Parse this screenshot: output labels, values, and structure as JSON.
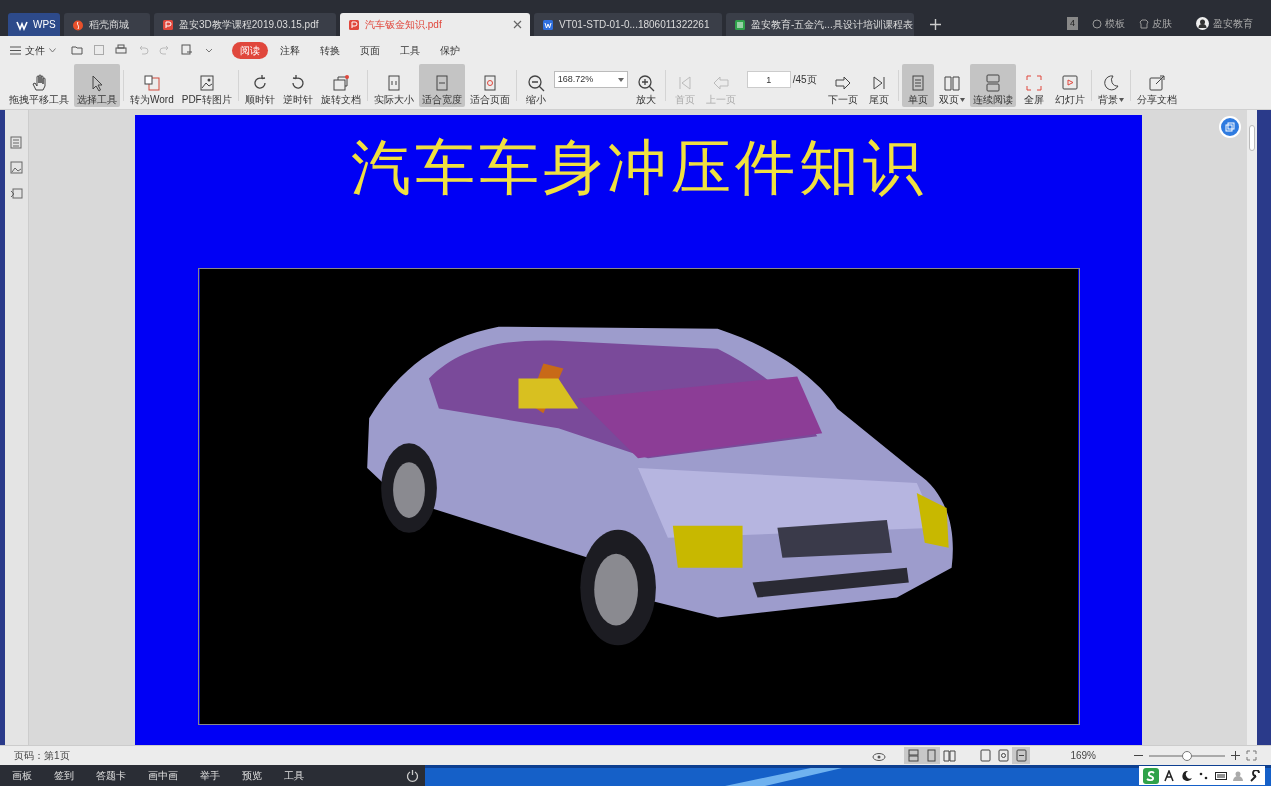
{
  "tabs": [
    {
      "label": "WPS",
      "kind": "home",
      "selected": false
    },
    {
      "label": "稻壳商城",
      "kind": "store",
      "selected": false
    },
    {
      "label": "盈安3D教学课程2019.03.15.pdf",
      "kind": "pdf",
      "selected": false
    },
    {
      "label": "汽车钣金知识.pdf",
      "kind": "pdf",
      "selected": true
    },
    {
      "label": "VT01-STD-01-0...1806011322261",
      "kind": "doc",
      "selected": false
    },
    {
      "label": "盈安教育-五金汽...具设计培训课程表",
      "kind": "sheet",
      "selected": false
    }
  ],
  "title_right": {
    "badge": "4",
    "template": "模板",
    "skin": "皮肤",
    "user": "盈安教育"
  },
  "menu": {
    "file": "文件",
    "items": [
      {
        "label": "阅读",
        "selected": true
      },
      {
        "label": "注释",
        "selected": false
      },
      {
        "label": "转换",
        "selected": false
      },
      {
        "label": "页面",
        "selected": false
      },
      {
        "label": "工具",
        "selected": false
      },
      {
        "label": "保护",
        "selected": false
      }
    ]
  },
  "toolbar": [
    [
      {
        "kind": "button",
        "label": "拖拽平移工具",
        "selected": false,
        "disabled": false
      },
      {
        "kind": "button",
        "label": "选择工具",
        "selected": true,
        "disabled": false
      }
    ],
    [
      {
        "kind": "button",
        "label": "转为Word",
        "selected": false,
        "disabled": false
      },
      {
        "kind": "button",
        "label": "PDF转图片",
        "selected": false,
        "disabled": false
      }
    ],
    [
      {
        "kind": "button",
        "label": "顺时针",
        "selected": false,
        "disabled": false
      },
      {
        "kind": "button",
        "label": "逆时针",
        "selected": false,
        "disabled": false
      },
      {
        "kind": "button",
        "label": "旋转文档",
        "selected": false,
        "disabled": false
      }
    ],
    [
      {
        "kind": "button",
        "label": "实际大小",
        "selected": false,
        "disabled": false
      },
      {
        "kind": "button",
        "label": "适合宽度",
        "selected": true,
        "disabled": false
      },
      {
        "kind": "button",
        "label": "适合页面",
        "selected": false,
        "disabled": false
      }
    ],
    [
      {
        "kind": "button",
        "label": "缩小",
        "selected": false,
        "disabled": false
      },
      {
        "kind": "zoom",
        "value": "168.72%"
      },
      {
        "kind": "button",
        "label": "放大",
        "selected": false,
        "disabled": false
      }
    ],
    [
      {
        "kind": "button",
        "label": "首页",
        "selected": false,
        "disabled": true
      },
      {
        "kind": "button",
        "label": "上一页",
        "selected": false,
        "disabled": true
      },
      {
        "kind": "page",
        "value": "1",
        "total": "/45页"
      },
      {
        "kind": "button",
        "label": "下一页",
        "selected": false,
        "disabled": false
      },
      {
        "kind": "button",
        "label": "尾页",
        "selected": false,
        "disabled": false
      }
    ],
    [
      {
        "kind": "button",
        "label": "单页",
        "selected": true,
        "disabled": false
      },
      {
        "kind": "button",
        "label": "双页",
        "selected": false,
        "disabled": false,
        "dropdown": true
      },
      {
        "kind": "button",
        "label": "连续阅读",
        "selected": true,
        "disabled": false
      },
      {
        "kind": "button",
        "label": "全屏",
        "selected": false,
        "disabled": false
      },
      {
        "kind": "button",
        "label": "幻灯片",
        "selected": false,
        "disabled": false
      }
    ],
    [
      {
        "kind": "button",
        "label": "背景",
        "selected": false,
        "disabled": false,
        "dropdown": true
      }
    ],
    [
      {
        "kind": "button",
        "label": "分享文档",
        "selected": false,
        "disabled": false
      }
    ]
  ],
  "slide": {
    "title": "汽车车身冲压件知识"
  },
  "status_bar": {
    "page": "页码：第1页",
    "zoom": "169%",
    "zoom_slider": {
      "level": 0.5
    },
    "view_modes": [
      {
        "selected": true
      },
      {
        "selected": true
      },
      {
        "selected": false
      }
    ],
    "fit_modes": [
      {
        "selected": false
      },
      {
        "selected": false
      },
      {
        "selected": true
      }
    ]
  },
  "taskbar": {
    "items": [
      "画板",
      "签到",
      "答题卡",
      "画中画",
      "举手",
      "预览",
      "工具"
    ]
  }
}
